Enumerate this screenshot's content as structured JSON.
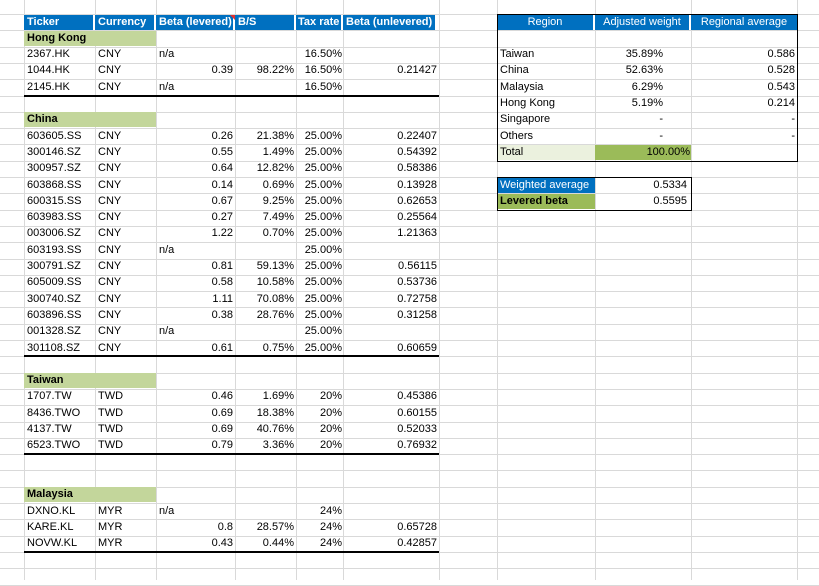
{
  "headers": [
    "Ticker",
    "Currency",
    "Beta (levered)",
    "B/S",
    "Tax rate",
    "Beta (unlevered)"
  ],
  "groups": [
    {
      "name": "Hong Kong",
      "rows": [
        [
          "2367.HK",
          "CNY",
          "n/a",
          "",
          "16.50%",
          ""
        ],
        [
          "1044.HK",
          "CNY",
          "0.39",
          "98.22%",
          "16.50%",
          "0.21427"
        ],
        [
          "2145.HK",
          "CNY",
          "n/a",
          "",
          "16.50%",
          ""
        ]
      ]
    },
    {
      "name": "China",
      "rows": [
        [
          "603605.SS",
          "CNY",
          "0.26",
          "21.38%",
          "25.00%",
          "0.22407"
        ],
        [
          "300146.SZ",
          "CNY",
          "0.55",
          "1.49%",
          "25.00%",
          "0.54392"
        ],
        [
          "300957.SZ",
          "CNY",
          "0.64",
          "12.82%",
          "25.00%",
          "0.58386"
        ],
        [
          "603868.SS",
          "CNY",
          "0.14",
          "0.69%",
          "25.00%",
          "0.13928"
        ],
        [
          "600315.SS",
          "CNY",
          "0.67",
          "9.25%",
          "25.00%",
          "0.62653"
        ],
        [
          "603983.SS",
          "CNY",
          "0.27",
          "7.49%",
          "25.00%",
          "0.25564"
        ],
        [
          "003006.SZ",
          "CNY",
          "1.22",
          "0.70%",
          "25.00%",
          "1.21363"
        ],
        [
          "603193.SS",
          "CNY",
          "n/a",
          "",
          "25.00%",
          ""
        ],
        [
          "300791.SZ",
          "CNY",
          "0.81",
          "59.13%",
          "25.00%",
          "0.56115"
        ],
        [
          "605009.SS",
          "CNY",
          "0.58",
          "10.58%",
          "25.00%",
          "0.53736"
        ],
        [
          "300740.SZ",
          "CNY",
          "1.11",
          "70.08%",
          "25.00%",
          "0.72758"
        ],
        [
          "603896.SS",
          "CNY",
          "0.38",
          "28.76%",
          "25.00%",
          "0.31258"
        ],
        [
          "001328.SZ",
          "CNY",
          "n/a",
          "",
          "25.00%",
          ""
        ],
        [
          "301108.SZ",
          "CNY",
          "0.61",
          "0.75%",
          "25.00%",
          "0.60659"
        ]
      ]
    },
    {
      "name": "Taiwan",
      "rows": [
        [
          "1707.TW",
          "TWD",
          "0.46",
          "1.69%",
          "20%",
          "0.45386"
        ],
        [
          "8436.TWO",
          "TWD",
          "0.69",
          "18.38%",
          "20%",
          "0.60155"
        ],
        [
          "4137.TW",
          "TWD",
          "0.69",
          "40.76%",
          "20%",
          "0.52033"
        ],
        [
          "6523.TWO",
          "TWD",
          "0.79",
          "3.36%",
          "20%",
          "0.76932"
        ]
      ]
    },
    {
      "name": "Malaysia",
      "rows": [
        [
          "DXNO.KL",
          "MYR",
          "n/a",
          "",
          "24%",
          ""
        ],
        [
          "KARE.KL",
          "MYR",
          "0.8",
          "28.57%",
          "24%",
          "0.65728"
        ],
        [
          "NOVW.KL",
          "MYR",
          "0.43",
          "0.44%",
          "24%",
          "0.42857"
        ]
      ]
    }
  ],
  "region_table": {
    "headers": [
      "Region",
      "Adjusted weight",
      "Regional average"
    ],
    "rows": [
      [
        "Taiwan",
        "35.89%",
        "0.586"
      ],
      [
        "China",
        "52.63%",
        "0.528"
      ],
      [
        "Malaysia",
        "6.29%",
        "0.543"
      ],
      [
        "Hong Kong",
        "5.19%",
        "0.214"
      ],
      [
        "Singapore",
        "-",
        "-"
      ],
      [
        "Others",
        "-",
        "-"
      ]
    ],
    "total_label": "Total",
    "total_value": "100.00%"
  },
  "summary": {
    "weighted_average_label": "Weighted average",
    "weighted_average_value": "0.5334",
    "levered_beta_label": "Levered beta",
    "levered_beta_value": "0.5595"
  },
  "colors": {
    "header_blue": "#0070c0",
    "section_green": "#c3d69b",
    "total_green": "#9bbb59",
    "total_light": "#ebf1de",
    "grid": "#d9d9d9"
  }
}
